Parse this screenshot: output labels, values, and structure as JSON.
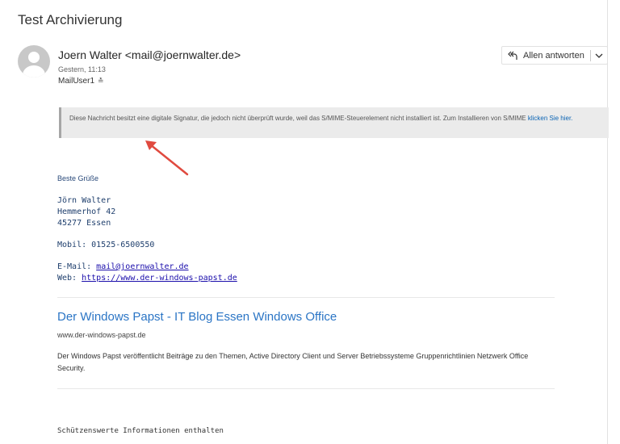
{
  "message": {
    "subject": "Test Archivierung",
    "sender": "Joern Walter <mail@joernwalter.de>",
    "date": "Gestern, 11:13",
    "recipient": "MailUser1"
  },
  "toolbar": {
    "reply_all_label": "Allen antworten"
  },
  "notice": {
    "text": "Diese Nachricht besitzt eine digitale Signatur, die jedoch nicht überprüft wurde, weil das S/MIME-Steuerelement nicht installiert ist. Zum Installieren von S/MIME ",
    "link": "klicken Sie hier."
  },
  "body": {
    "greeting": "Beste Grüße",
    "name": "Jörn Walter",
    "street": "Hemmerhof 42",
    "city": "45277 Essen",
    "mobile": "Mobil: 01525-6500550",
    "email_label": "E-Mail: ",
    "email": "mail@joernwalter.de",
    "web_label": "Web: ",
    "web": "https://www.der-windows-papst.de"
  },
  "link_preview": {
    "title": "Der Windows Papst - IT Blog Essen Windows Office",
    "url": "www.der-windows-papst.de",
    "description": "Der Windows Papst veröffentlicht Beiträge zu den Themen, Active Directory Client und Server Betriebssysteme Gruppenrichtlinien Netzwerk Office Security."
  },
  "footer": {
    "classification": "Schützenswerte Informationen enthalten"
  },
  "icons": {
    "avatar": "person-avatar-icon",
    "reply_all": "reply-all-icon",
    "dropdown": "chevron-down-icon",
    "annotation": "red-arrow-annotation"
  },
  "colors": {
    "link": "#0b64b4",
    "preview_title": "#2b75c5",
    "signature": "#1f3f6d",
    "arrow": "#e04a3f"
  }
}
